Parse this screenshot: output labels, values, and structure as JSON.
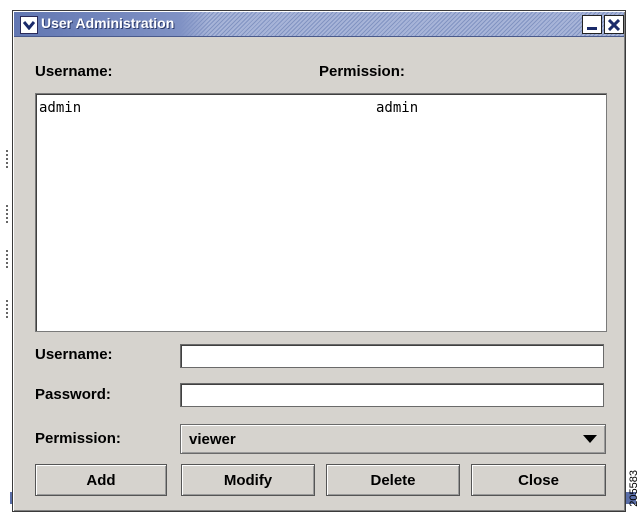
{
  "window": {
    "title": "User Administration"
  },
  "list": {
    "headers": {
      "username": "Username:",
      "permission": "Permission:"
    },
    "rows": [
      {
        "username": "admin",
        "permission": "admin"
      }
    ]
  },
  "form": {
    "username_label": "Username:",
    "username_value": "",
    "password_label": "Password:",
    "password_value": "",
    "permission_label": "Permission:",
    "permission_value": "viewer"
  },
  "buttons": {
    "add": "Add",
    "modify": "Modify",
    "delete": "Delete",
    "close": "Close"
  },
  "figure_code": "205583",
  "icons": {
    "menu": "chevron-down-icon",
    "minimize": "minimize-icon",
    "close": "close-icon",
    "dropdown": "dropdown-arrow-icon"
  },
  "colors": {
    "titlebar": "#8f9fc8",
    "window_bg": "#d6d3ce",
    "accent": "#5a6ea8"
  }
}
